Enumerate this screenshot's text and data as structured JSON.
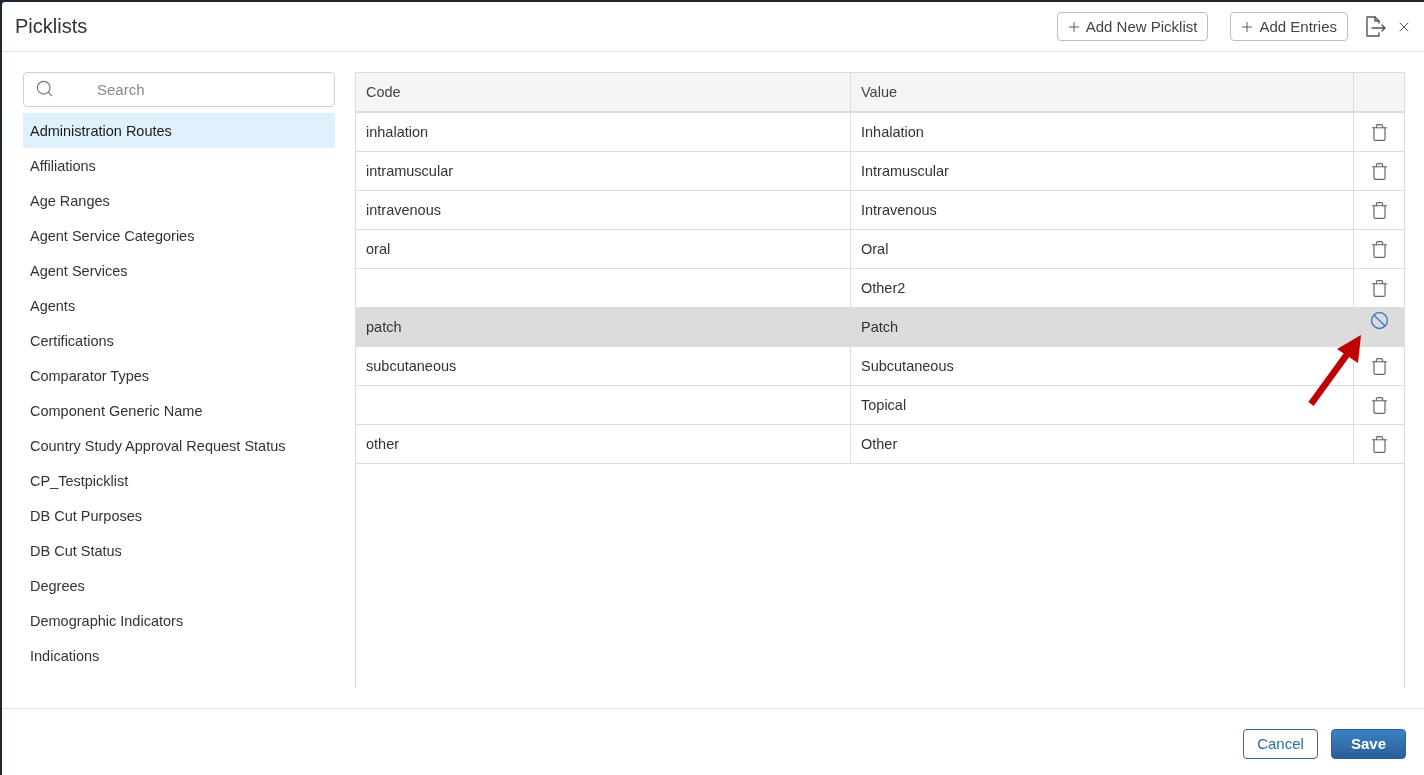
{
  "dialog": {
    "title": "Picklists"
  },
  "header_buttons": [
    {
      "label": "Add New Picklist"
    },
    {
      "label": "Add Entries"
    }
  ],
  "search": {
    "placeholder": "Search"
  },
  "picklists": [
    {
      "label": "Administration Routes",
      "selected": true
    },
    {
      "label": "Affiliations",
      "selected": false
    },
    {
      "label": "Age Ranges",
      "selected": false
    },
    {
      "label": "Agent Service Categories",
      "selected": false
    },
    {
      "label": "Agent Services",
      "selected": false
    },
    {
      "label": "Agents",
      "selected": false
    },
    {
      "label": "Certifications",
      "selected": false
    },
    {
      "label": "Comparator Types",
      "selected": false
    },
    {
      "label": "Component Generic Name",
      "selected": false
    },
    {
      "label": "Country Study Approval Request Status",
      "selected": false
    },
    {
      "label": "CP_Testpicklist",
      "selected": false
    },
    {
      "label": "DB Cut Purposes",
      "selected": false
    },
    {
      "label": "DB Cut Status",
      "selected": false
    },
    {
      "label": "Degrees",
      "selected": false
    },
    {
      "label": "Demographic Indicators",
      "selected": false
    },
    {
      "label": "Indications",
      "selected": false
    }
  ],
  "table": {
    "columns": [
      "Code",
      "Value"
    ],
    "rows": [
      {
        "code": "inhalation",
        "value": "Inhalation",
        "highlighted": false,
        "kind": "deletable"
      },
      {
        "code": "intramuscular",
        "value": "Intramuscular",
        "highlighted": false,
        "kind": "deletable"
      },
      {
        "code": "intravenous",
        "value": "Intravenous",
        "highlighted": false,
        "kind": "deletable"
      },
      {
        "code": "oral",
        "value": "Oral",
        "highlighted": false,
        "kind": "deletable"
      },
      {
        "value": "Other2",
        "highlighted": false,
        "kind": "deletable"
      },
      {
        "code": "patch",
        "value": "Patch",
        "highlighted": true,
        "kind": "blocked"
      },
      {
        "code": "subcutaneous",
        "value": "Subcutaneous",
        "highlighted": false,
        "kind": "deletable"
      },
      {
        "value": "Topical",
        "highlighted": false,
        "kind": "deletable"
      },
      {
        "code": "other",
        "value": "Other",
        "highlighted": false,
        "kind": "deletable"
      }
    ]
  },
  "footer_buttons": [
    {
      "label": "Cancel",
      "kind": "secondary"
    },
    {
      "label": "Save",
      "kind": "primary"
    }
  ]
}
